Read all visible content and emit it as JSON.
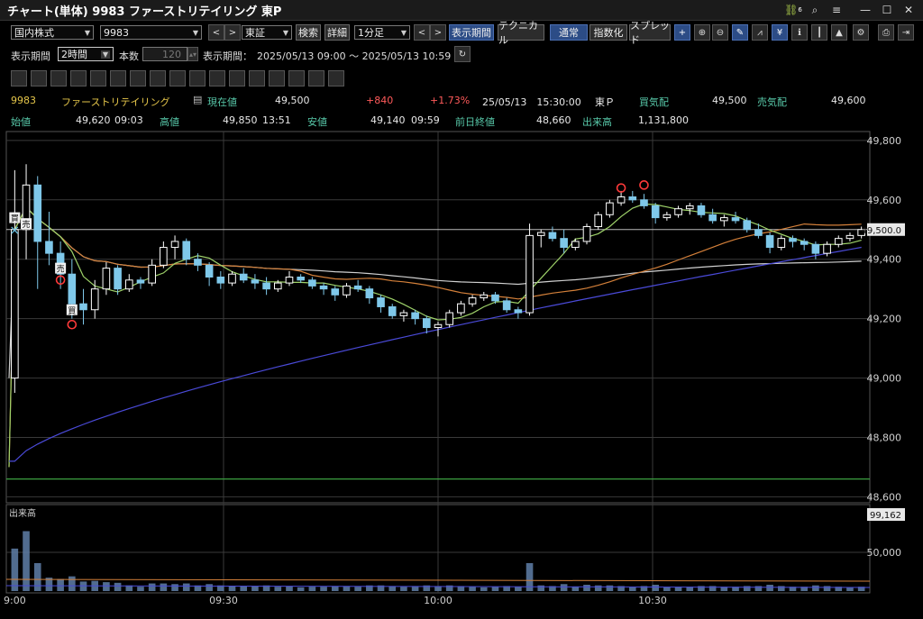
{
  "window": {
    "title": "チャート(単体) 9983 ファーストリテイリング 東P",
    "link_badge": "6"
  },
  "toolbar": {
    "market_select": "国内株式",
    "code_select": "9983",
    "exchange_select": "東証",
    "search_label": "検索",
    "detail_label": "詳細",
    "interval_select": "1分足",
    "display_period_label": "表示期間",
    "technical_label": "テクニカル",
    "normal_label": "通常",
    "index_label": "指数化",
    "spread_label": "スプレッド"
  },
  "period": {
    "label": "表示期間",
    "value": "2時間",
    "bars_label": "本数",
    "bars_value": "120",
    "range_label": "表示期間：",
    "range_value": "2025/05/13 09:00 ～ 2025/05/13 10:59"
  },
  "quote": {
    "code": "9983",
    "name": "ファーストリテイリング",
    "current_label": "現在値",
    "current": "49,500",
    "change": "+840",
    "change_pct": "+1.73%",
    "datetime": "25/05/13　15:30:00",
    "market": "東Ｐ",
    "bid_label": "買気配",
    "bid": "49,500",
    "ask_label": "売気配",
    "ask": "49,600",
    "open_label": "始値",
    "open": "49,620",
    "open_time": "09:03",
    "high_label": "高値",
    "high": "49,850",
    "high_time": "13:51",
    "low_label": "安値",
    "low": "49,140",
    "low_time": "09:59",
    "prev_close_label": "前日終値",
    "prev_close": "48,660",
    "volume_label": "出来高",
    "volume": "1,131,800"
  },
  "price_axis": {
    "ticks": [
      "49,800",
      "49,600",
      "49,400",
      "49,200",
      "49,000",
      "48,800",
      "48,600"
    ],
    "current_tag": "49,500.0"
  },
  "volume_panel": {
    "label": "出来高",
    "max_tag": "99,162",
    "tick": "50,000"
  },
  "time_axis": {
    "ticks": [
      "9:00",
      "09:30",
      "10:00",
      "10:30"
    ]
  },
  "markers": {
    "sell": "売",
    "buy": "買"
  },
  "colors": {
    "up": "#ffffff",
    "down": "#7fc8ea",
    "ma_short": "#9fd36a",
    "ma_mid": "#d4803a",
    "ma_long": "#d0d0d0",
    "vwap": "#4a4ad8",
    "prev_close_line": "#3ca040"
  },
  "icons": [
    "link-icon",
    "search-icon",
    "menu-icon",
    "minimize-icon",
    "maximize-icon",
    "close-icon"
  ],
  "chart_data": {
    "type": "candlestick",
    "x_range": [
      "09:00",
      "10:59"
    ],
    "ylim": [
      48580,
      49830
    ],
    "prev_close": 48660,
    "current_price": 49500,
    "candles": [
      [
        49000,
        49700,
        48950,
        49500
      ],
      [
        49500,
        49720,
        49400,
        49650
      ],
      [
        49650,
        49680,
        49300,
        49460
      ],
      [
        49460,
        49560,
        49380,
        49420
      ],
      [
        49420,
        49460,
        49300,
        49350
      ],
      [
        49350,
        49400,
        49200,
        49250
      ],
      [
        49250,
        49300,
        49180,
        49230
      ],
      [
        49230,
        49330,
        49200,
        49300
      ],
      [
        49300,
        49390,
        49280,
        49370
      ],
      [
        49370,
        49380,
        49280,
        49300
      ],
      [
        49300,
        49350,
        49290,
        49330
      ],
      [
        49330,
        49340,
        49300,
        49320
      ],
      [
        49320,
        49400,
        49310,
        49380
      ],
      [
        49380,
        49460,
        49370,
        49440
      ],
      [
        49440,
        49480,
        49400,
        49460
      ],
      [
        49460,
        49470,
        49380,
        49400
      ],
      [
        49400,
        49420,
        49360,
        49380
      ],
      [
        49380,
        49390,
        49310,
        49340
      ],
      [
        49340,
        49360,
        49300,
        49320
      ],
      [
        49320,
        49360,
        49310,
        49350
      ],
      [
        49350,
        49370,
        49320,
        49330
      ],
      [
        49330,
        49350,
        49300,
        49320
      ],
      [
        49320,
        49340,
        49280,
        49300
      ],
      [
        49300,
        49330,
        49290,
        49320
      ],
      [
        49320,
        49360,
        49310,
        49340
      ],
      [
        49340,
        49350,
        49320,
        49330
      ],
      [
        49330,
        49340,
        49300,
        49310
      ],
      [
        49310,
        49320,
        49280,
        49300
      ],
      [
        49300,
        49310,
        49260,
        49280
      ],
      [
        49280,
        49320,
        49270,
        49310
      ],
      [
        49310,
        49330,
        49290,
        49300
      ],
      [
        49300,
        49310,
        49250,
        49270
      ],
      [
        49270,
        49280,
        49220,
        49240
      ],
      [
        49240,
        49250,
        49200,
        49210
      ],
      [
        49210,
        49230,
        49190,
        49220
      ],
      [
        49220,
        49230,
        49180,
        49200
      ],
      [
        49200,
        49210,
        49150,
        49170
      ],
      [
        49170,
        49190,
        49140,
        49180
      ],
      [
        49180,
        49230,
        49170,
        49220
      ],
      [
        49220,
        49260,
        49210,
        49250
      ],
      [
        49250,
        49280,
        49240,
        49270
      ],
      [
        49270,
        49290,
        49260,
        49280
      ],
      [
        49280,
        49290,
        49250,
        49260
      ],
      [
        49260,
        49270,
        49220,
        49230
      ],
      [
        49230,
        49240,
        49200,
        49220
      ],
      [
        49220,
        49520,
        49210,
        49480
      ],
      [
        49480,
        49500,
        49440,
        49490
      ],
      [
        49490,
        49510,
        49460,
        49470
      ],
      [
        49470,
        49500,
        49420,
        49440
      ],
      [
        49440,
        49470,
        49430,
        49460
      ],
      [
        49460,
        49520,
        49450,
        49510
      ],
      [
        49510,
        49560,
        49500,
        49550
      ],
      [
        49550,
        49600,
        49540,
        49590
      ],
      [
        49590,
        49630,
        49580,
        49610
      ],
      [
        49610,
        49630,
        49590,
        49600
      ],
      [
        49600,
        49620,
        49570,
        49580
      ],
      [
        49580,
        49590,
        49520,
        49540
      ],
      [
        49540,
        49560,
        49530,
        49550
      ],
      [
        49550,
        49580,
        49540,
        49570
      ],
      [
        49570,
        49590,
        49550,
        49580
      ],
      [
        49580,
        49590,
        49540,
        49550
      ],
      [
        49550,
        49570,
        49520,
        49530
      ],
      [
        49530,
        49550,
        49510,
        49540
      ],
      [
        49540,
        49560,
        49520,
        49530
      ],
      [
        49530,
        49540,
        49490,
        49500
      ],
      [
        49500,
        49520,
        49470,
        49480
      ],
      [
        49480,
        49490,
        49420,
        49440
      ],
      [
        49440,
        49480,
        49430,
        49470
      ],
      [
        49470,
        49480,
        49440,
        49460
      ],
      [
        49460,
        49470,
        49430,
        49450
      ],
      [
        49450,
        49460,
        49400,
        49420
      ],
      [
        49420,
        49460,
        49410,
        49450
      ],
      [
        49450,
        49480,
        49440,
        49470
      ],
      [
        49470,
        49490,
        49460,
        49480
      ],
      [
        49480,
        49510,
        49470,
        49500
      ]
    ],
    "volume_max": 99162
  }
}
